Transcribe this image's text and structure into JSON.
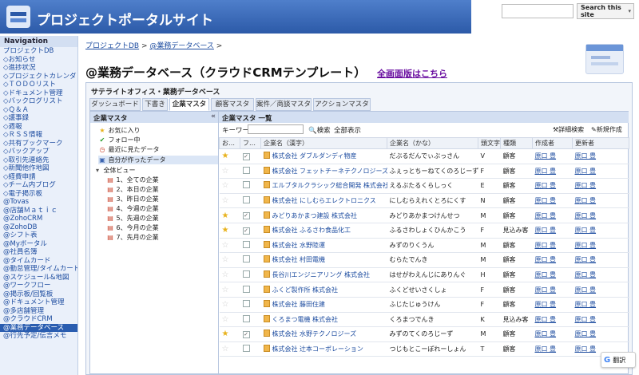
{
  "header": {
    "site_title": "プロジェクトポータルサイト"
  },
  "search": {
    "button_label": "Search this site",
    "arrow": "▾"
  },
  "sidebar": {
    "heading": "Navigation",
    "items": [
      "プロジェクトDB",
      "◇お知らせ",
      "◇進捗状況",
      "◇プロジェクトカレンダ",
      "◇ＴＯＤＯリスト",
      "◇ドキュメント管理",
      "◇バックログリスト",
      "◇Ｑ＆Ａ",
      "◇議事録",
      "◇週報",
      "◇ＲＳＳ情報",
      "◇共有ブックマーク",
      "◇バックアップ",
      "◇取引先連絡先",
      "◇新聞他作地図",
      "◇経費申請",
      "◇チーム内ブログ",
      "◇電子掲示板",
      "@Tovas",
      "@店舗Ｍａｔｉｃ",
      "@ZohoCRM",
      "@ZohoDB",
      "@シフト表",
      "@Myポータル",
      "@社員名簿",
      "@タイムカード",
      "@勤怠管理/タイムカード",
      "@スケジュール&地図",
      "@ワークフロー",
      "@掲示板/回覧板",
      "@ドキュメント管理",
      "@多店舗管理",
      "@クラウドCRM",
      "@業務データベース",
      "@行先予定/伝言メモ"
    ],
    "active_index": 33
  },
  "breadcrumb": {
    "root": "プロジェクトDB",
    "sep1": " > ",
    "current": "@業務データベース",
    "sep2": " >"
  },
  "page": {
    "title": "@業務データベース（クラウドCRMテンプレート）",
    "full_link": "全画面版はこちら"
  },
  "panel": {
    "title": "サテライトオフィス・業務データベース",
    "tabs": [
      "ダッシュボード",
      "下書き",
      "企業マスタ",
      "顧客マスタ",
      "案件／商談マスタ",
      "アクションマスタ"
    ],
    "active_tab": 2
  },
  "left_pane": {
    "heading": "企業マスタ",
    "collapse": "«",
    "tree": [
      {
        "icon": "★",
        "label": "お気に入り"
      },
      {
        "icon": "✔",
        "label": "フォロー中"
      },
      {
        "icon": "◷",
        "label": "最近に見たデータ"
      },
      {
        "icon": "▣",
        "label": "自分が作ったデータ"
      },
      {
        "icon": "▾",
        "label": "全体ビュー"
      },
      {
        "icon": "▤",
        "label": "1、全ての企業"
      },
      {
        "icon": "▤",
        "label": "2、本日の企業"
      },
      {
        "icon": "▤",
        "label": "3、昨日の企業"
      },
      {
        "icon": "▤",
        "label": "4、今週の企業"
      },
      {
        "icon": "▤",
        "label": "5、先週の企業"
      },
      {
        "icon": "▤",
        "label": "6、今月の企業"
      },
      {
        "icon": "▤",
        "label": "7、先月の企業"
      }
    ]
  },
  "list": {
    "heading": "企業マスタ 一覧",
    "keyword_label": "キーワード",
    "search_label": "検索",
    "show_all": "全部表示",
    "advanced": "詳細検索",
    "new": "新規作成",
    "columns": [
      "お…",
      "フ…",
      "企業名（漢字）",
      "企業名（かな）",
      "頭文字",
      "種類",
      "作成者",
      "更新者"
    ],
    "rows": [
      {
        "fav": true,
        "follow": true,
        "name": "株式会社 ダブルダンディ物産",
        "kana": "だぶるだんでぃぶっさん",
        "initial": "V",
        "type": "顧客",
        "creator": "原口 豊",
        "updater": "原口 豊"
      },
      {
        "fav": false,
        "follow": false,
        "name": "株式会社 フェットチーネテクノロジーズ",
        "kana": "ふぇっとちーねてくのろじーず",
        "initial": "F",
        "type": "顧客",
        "creator": "原口 豊",
        "updater": "原口 豊"
      },
      {
        "fav": false,
        "follow": false,
        "name": "エルブタルクラシック総合開発 株式会社",
        "kana": "えるぶたるくらしっく",
        "initial": "E",
        "type": "顧客",
        "creator": "原口 豊",
        "updater": "原口 豊"
      },
      {
        "fav": false,
        "follow": false,
        "name": "株式会社 にしむらエレクトロニクス",
        "kana": "にしむらえれくとろにくす",
        "initial": "N",
        "type": "顧客",
        "creator": "原口 豊",
        "updater": "原口 豊"
      },
      {
        "fav": true,
        "follow": true,
        "name": "みどりあかまつ建設 株式会社",
        "kana": "みどりあかまつけんせつ",
        "initial": "M",
        "type": "顧客",
        "creator": "原口 豊",
        "updater": "原口 豊"
      },
      {
        "fav": true,
        "follow": true,
        "name": "株式会社 ふるさわ食品化工",
        "kana": "ふるさわしょくひんかこう",
        "initial": "F",
        "type": "見込み客",
        "creator": "原口 豊",
        "updater": "原口 豊"
      },
      {
        "fav": false,
        "follow": false,
        "name": "株式会社 水野陸運",
        "kana": "みずのりくうん",
        "initial": "M",
        "type": "顧客",
        "creator": "原口 豊",
        "updater": "原口 豊"
      },
      {
        "fav": false,
        "follow": false,
        "name": "株式会社 村田電機",
        "kana": "むらたでんき",
        "initial": "M",
        "type": "顧客",
        "creator": "原口 豊",
        "updater": "原口 豊"
      },
      {
        "fav": false,
        "follow": false,
        "name": "長谷川エンジニアリング 株式会社",
        "kana": "はせがわえんじにありんぐ",
        "initial": "H",
        "type": "顧客",
        "creator": "原口 豊",
        "updater": "原口 豊"
      },
      {
        "fav": false,
        "follow": false,
        "name": "ふくど製作所 株式会社",
        "kana": "ふくどせいさくしょ",
        "initial": "F",
        "type": "顧客",
        "creator": "原口 豊",
        "updater": "原口 豊"
      },
      {
        "fav": false,
        "follow": false,
        "name": "株式会社 藤田住建",
        "kana": "ふじたじゅうけん",
        "initial": "F",
        "type": "顧客",
        "creator": "原口 豊",
        "updater": "原口 豊"
      },
      {
        "fav": false,
        "follow": false,
        "name": "くろまつ電機 株式会社",
        "kana": "くろまつでんき",
        "initial": "K",
        "type": "見込み客",
        "creator": "原口 豊",
        "updater": "原口 豊"
      },
      {
        "fav": true,
        "follow": true,
        "name": "株式会社 水野テクノロジーズ",
        "kana": "みずのてくのろじーず",
        "initial": "M",
        "type": "顧客",
        "creator": "原口 豊",
        "updater": "原口 豊"
      },
      {
        "fav": false,
        "follow": false,
        "name": "株式会社 辻本コーポレーション",
        "kana": "つじもとこーぽれーしょん",
        "initial": "T",
        "type": "顧客",
        "creator": "原口 豊",
        "updater": "原口 豊"
      }
    ]
  },
  "translate": {
    "g": "G",
    "label": "翻訳"
  }
}
